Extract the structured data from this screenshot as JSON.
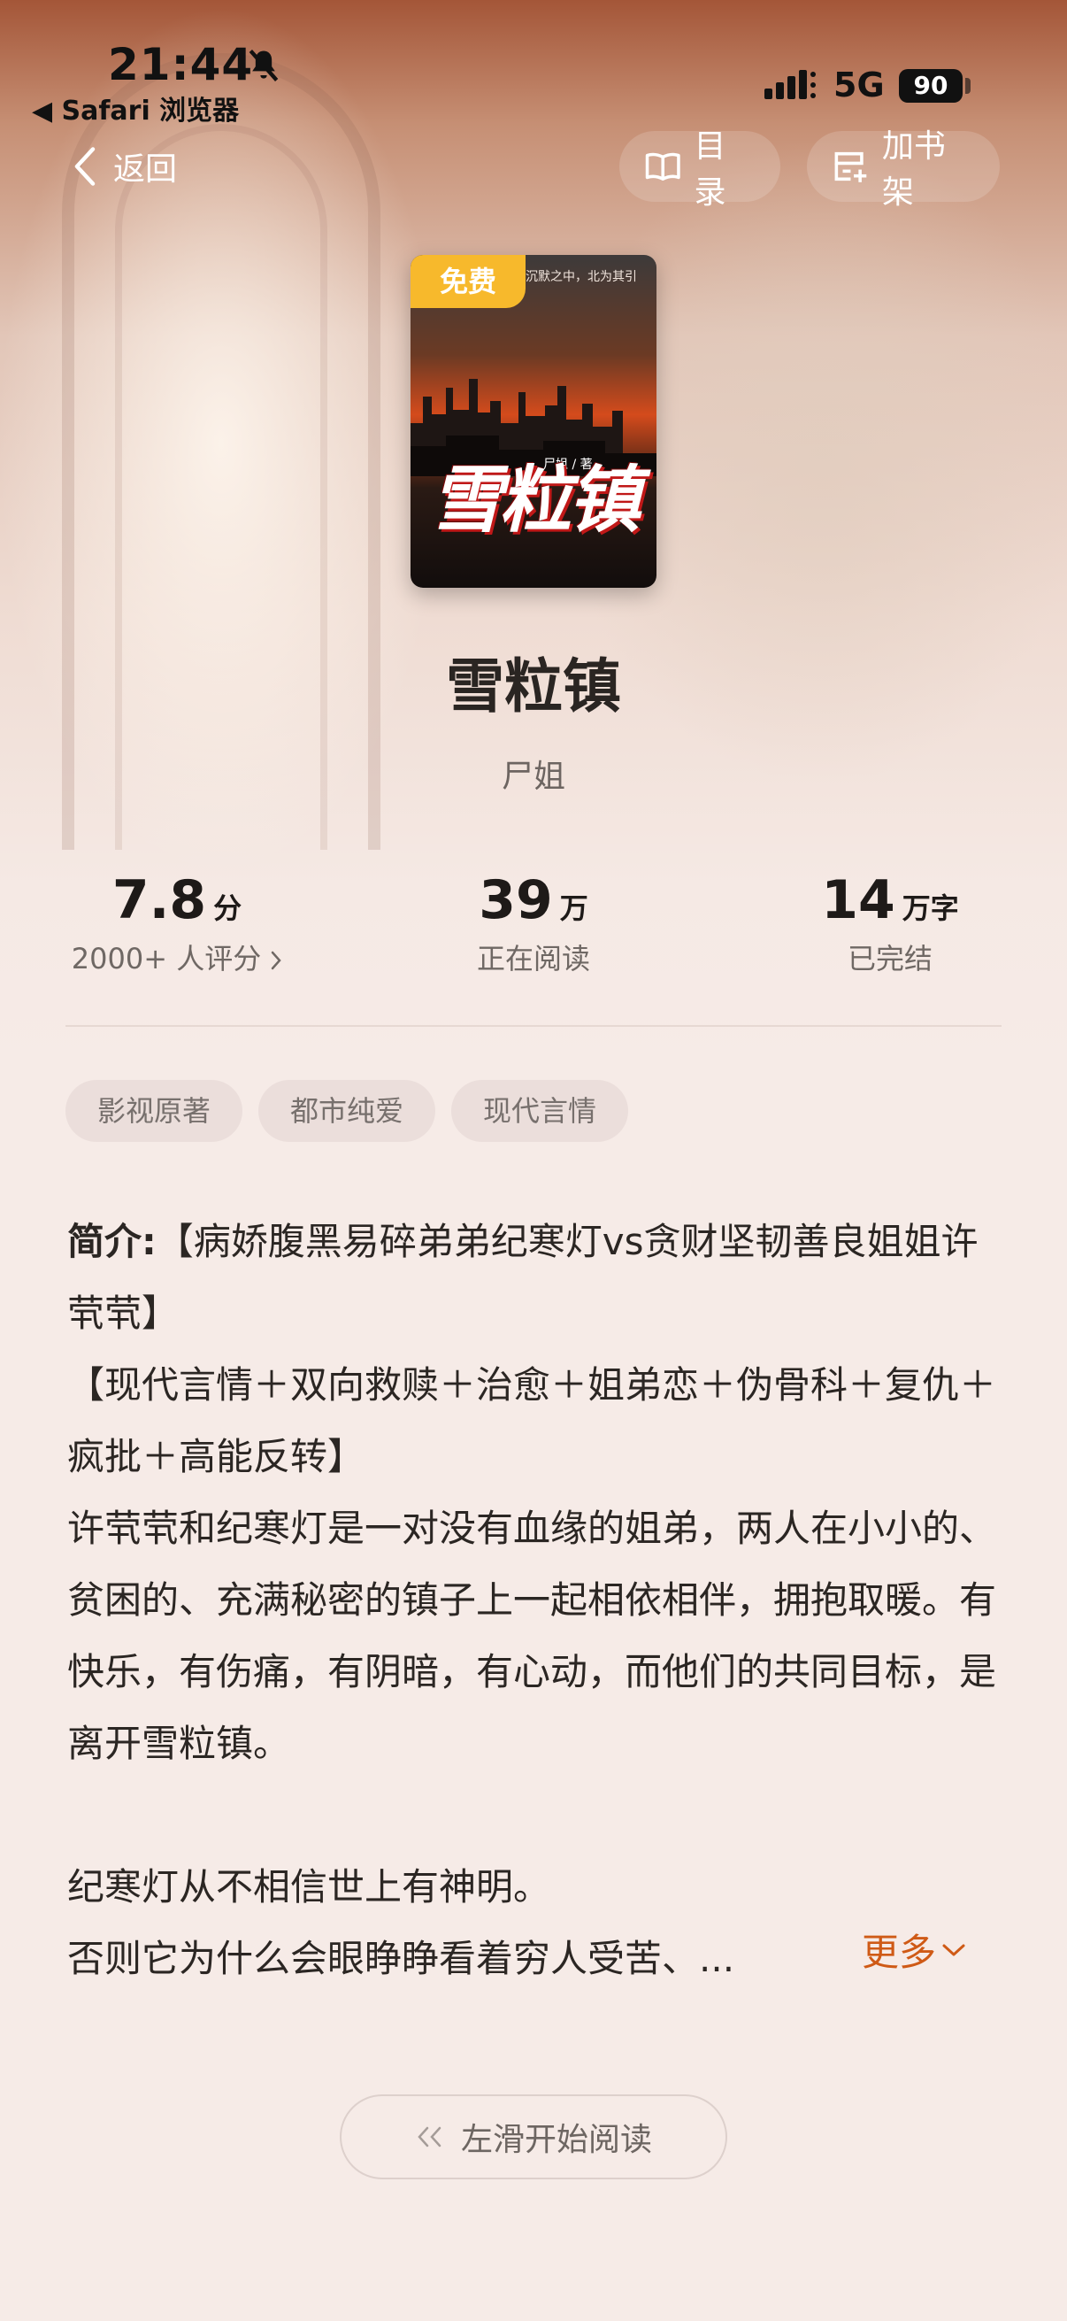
{
  "status_bar": {
    "time": "21:44",
    "back_app": "◀ Safari 浏览器",
    "network": "5G",
    "battery": "90"
  },
  "nav": {
    "back_label": "返回",
    "toc_label": "目录",
    "shelf_label": "加书架"
  },
  "cover": {
    "badge": "免费",
    "title_art": "雪粒镇",
    "author_art": "尸姐 / 著",
    "tagline": "沉默之中，北为其引"
  },
  "book": {
    "title": "雪粒镇",
    "author": "尸姐"
  },
  "stats": [
    {
      "value": "7.8",
      "unit": "分",
      "sub": "2000+ 人评分"
    },
    {
      "value": "39",
      "unit": "万",
      "sub": "正在阅读"
    },
    {
      "value": "14",
      "unit": "万字",
      "sub": "已完结"
    }
  ],
  "tags": [
    "影视原著",
    "都市纯爱",
    "现代言情"
  ],
  "intro": {
    "lead": "简介:",
    "line1": "【病娇腹黑易碎弟弟纪寒灯vs贪财坚韧善良姐姐许茕茕】",
    "line2": "【现代言情＋双向救赎＋治愈＋姐弟恋＋伪骨科＋复仇＋疯批＋高能反转】",
    "line3": "许茕茕和纪寒灯是一对没有血缘的姐弟，两人在小小的、贫困的、充满秘密的镇子上一起相依相伴，拥抱取暖。有快乐，有伤痛，有阴暗，有心动，而他们的共同目标，是离开雪粒镇。",
    "line4": "纪寒灯从不相信世上有神明。",
    "line5": "否则它为什么会眼睁睁看着穷人受苦、...",
    "more": "更多"
  },
  "start_reading": "左滑开始阅读",
  "colors": {
    "accent": "#cf5a16",
    "badge": "#f7b92c",
    "background": "#f6ebe7"
  }
}
